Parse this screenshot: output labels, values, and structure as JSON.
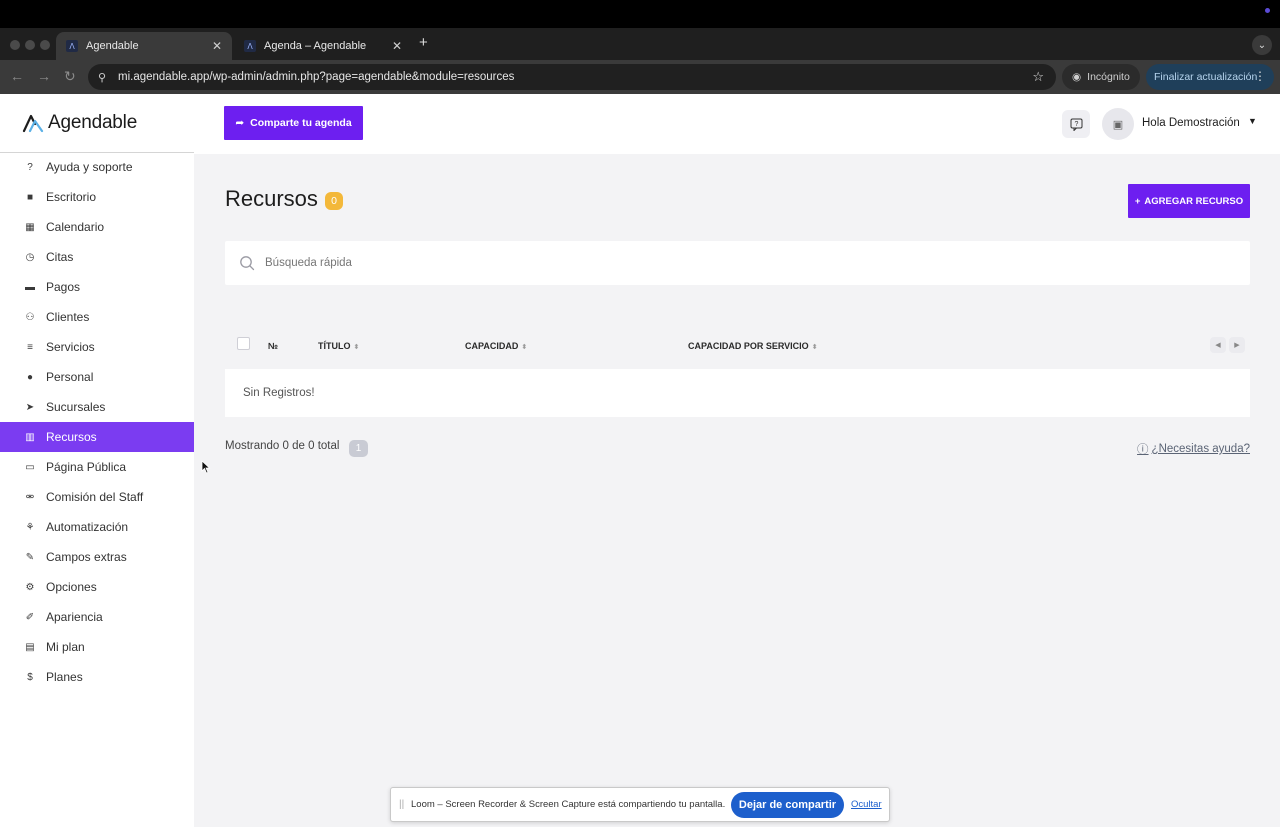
{
  "browser": {
    "tabs": [
      {
        "title": "Agendable",
        "active": true
      },
      {
        "title": "Agenda – Agendable",
        "active": false
      }
    ],
    "url": "mi.agendable.app/wp-admin/admin.php?page=agendable&module=resources",
    "incognito_label": "Incógnito",
    "update_label": "Finalizar actualización"
  },
  "brand": {
    "logo_text": "Agendable",
    "accent": "#6d1ff0"
  },
  "sidebar": {
    "items": [
      {
        "label": "Ayuda y soporte",
        "icon": "question-circle-icon",
        "glyph": "?"
      },
      {
        "label": "Escritorio",
        "icon": "box-icon",
        "glyph": "■"
      },
      {
        "label": "Calendario",
        "icon": "calendar-icon",
        "glyph": "▦"
      },
      {
        "label": "Citas",
        "icon": "clock-icon",
        "glyph": "◷"
      },
      {
        "label": "Pagos",
        "icon": "folder-icon",
        "glyph": "▬"
      },
      {
        "label": "Clientes",
        "icon": "users-icon",
        "glyph": "⚇"
      },
      {
        "label": "Servicios",
        "icon": "list-icon",
        "glyph": "≡"
      },
      {
        "label": "Personal",
        "icon": "user-icon",
        "glyph": "●"
      },
      {
        "label": "Sucursales",
        "icon": "location-arrow-icon",
        "glyph": "➤"
      },
      {
        "label": "Recursos",
        "icon": "building-icon",
        "glyph": "▥",
        "active": true
      },
      {
        "label": "Página Pública",
        "icon": "laptop-icon",
        "glyph": "▭"
      },
      {
        "label": "Comisión del Staff",
        "icon": "handshake-icon",
        "glyph": "⚮"
      },
      {
        "label": "Automatización",
        "icon": "sitemap-icon",
        "glyph": "⚘"
      },
      {
        "label": "Campos extras",
        "icon": "magic-wand-icon",
        "glyph": "✎"
      },
      {
        "label": "Opciones",
        "icon": "gear-icon",
        "glyph": "⚙"
      },
      {
        "label": "Apariencia",
        "icon": "brush-icon",
        "glyph": "✐"
      },
      {
        "label": "Mi plan",
        "icon": "credit-card-icon",
        "glyph": "▤"
      },
      {
        "label": "Planes",
        "icon": "dollar-icon",
        "glyph": "$"
      }
    ]
  },
  "topbar": {
    "share_label": "Comparte tu agenda",
    "user_greeting": "Hola Demostración"
  },
  "page": {
    "title": "Recursos",
    "count": "0",
    "add_label": "AGREGAR RECURSO",
    "search_placeholder": "Búsqueda rápida",
    "columns": {
      "number": "№",
      "title": "TÍTULO",
      "capacity": "CAPACIDAD",
      "capacity_per_service": "CAPACIDAD POR SERVICIO"
    },
    "empty_text": "Sin Registros!",
    "showing_text": "Mostrando 0 de 0 total",
    "current_page": "1",
    "help_link": "¿Necesitas ayuda?"
  },
  "loom": {
    "message": "Loom – Screen Recorder & Screen Capture está compartiendo tu pantalla.",
    "stop_label": "Dejar de compartir",
    "hide_label": "Ocultar"
  }
}
